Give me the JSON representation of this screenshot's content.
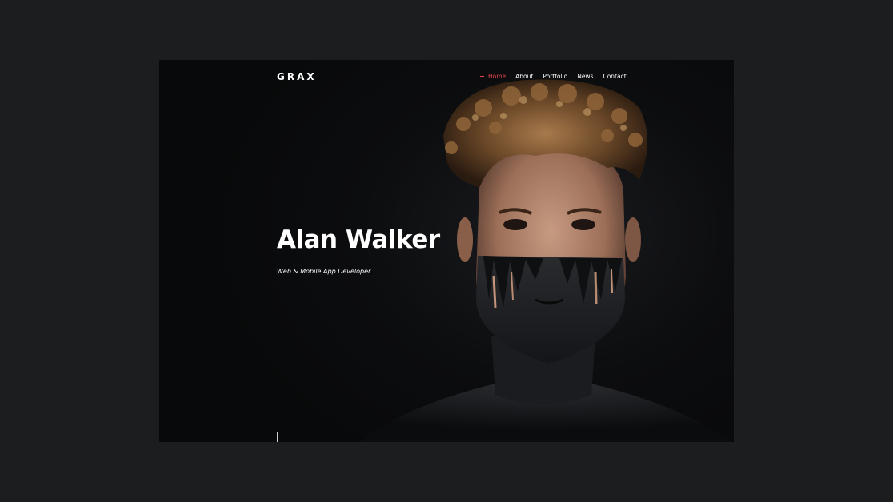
{
  "header": {
    "logo": "GRAX",
    "nav": [
      {
        "label": "Home",
        "active": true
      },
      {
        "label": "About",
        "active": false
      },
      {
        "label": "Portfolio",
        "active": false
      },
      {
        "label": "News",
        "active": false
      },
      {
        "label": "Contact",
        "active": false
      }
    ]
  },
  "hero": {
    "name": "Alan Walker",
    "subtitle": "Web & Mobile App Developer",
    "image": "portrait-photo"
  },
  "colors": {
    "accent": "#e5484d",
    "background": "#0a0b0d",
    "outer": "#1c1d1f",
    "text": "#ffffff"
  }
}
